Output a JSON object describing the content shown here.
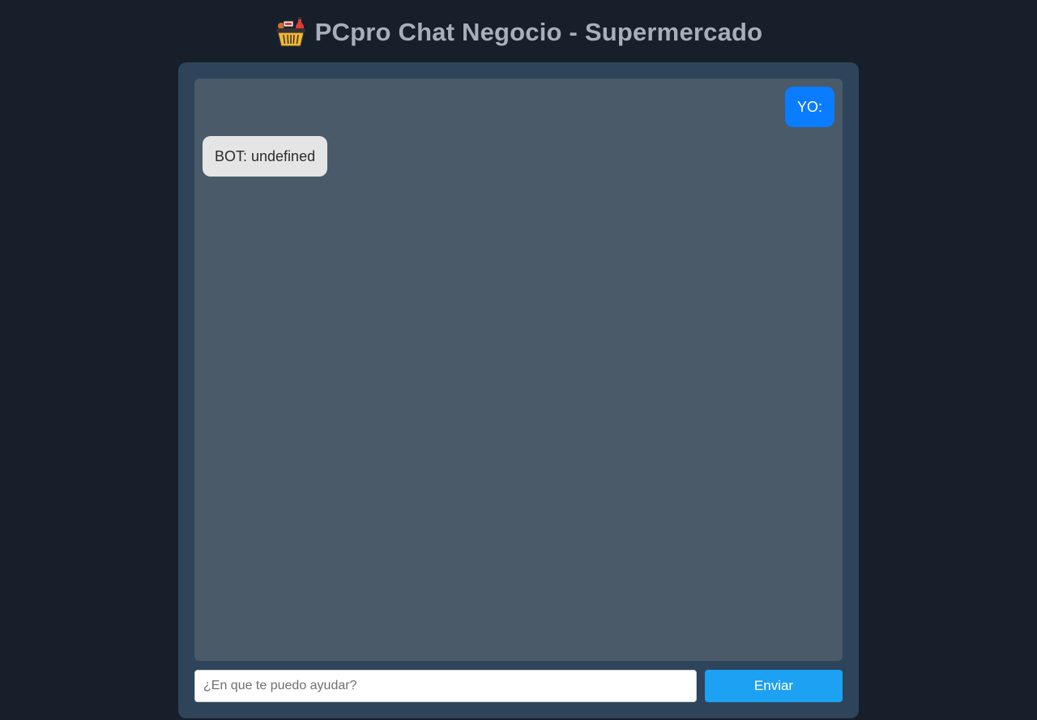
{
  "header": {
    "title": "PCpro Chat Negocio - Supermercado",
    "icon": "shopping-basket-icon"
  },
  "chat": {
    "messages": [
      {
        "sender": "user",
        "text": "YO:"
      },
      {
        "sender": "bot",
        "text": "BOT: undefined"
      }
    ]
  },
  "composer": {
    "placeholder": "¿En que te puedo ayudar?",
    "value": "",
    "send_label": "Enviar"
  },
  "colors": {
    "page_background": "#161f2a",
    "panel_background": "#2e445b",
    "chat_background": "#4a5a69",
    "user_bubble": "#0a7cff",
    "bot_bubble": "#e5e5e5",
    "send_button": "#1da1f2",
    "title_text": "#a6b0bb"
  }
}
